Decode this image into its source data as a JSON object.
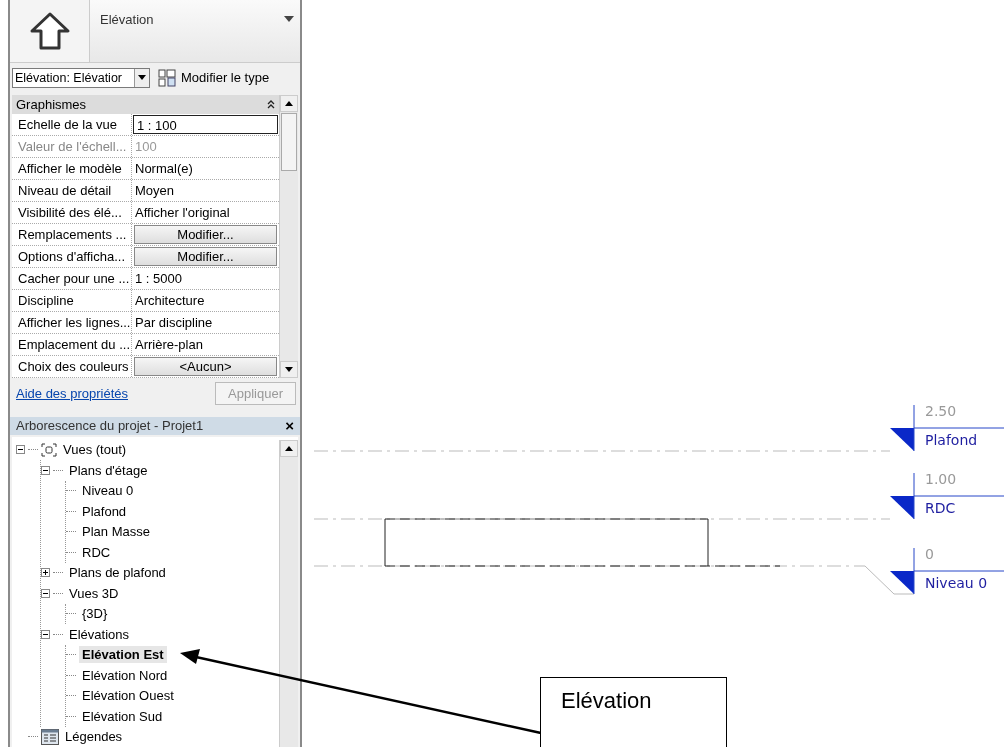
{
  "type_selector": {
    "label": "Elévation"
  },
  "instance_bar": {
    "combo_value": "Elévation: Elévatior",
    "edit_type_label": "Modifier le type"
  },
  "properties": {
    "group": "Graphismes",
    "expanded": true,
    "rows": [
      {
        "label": "Echelle de la vue",
        "value": "1 : 100",
        "kind": "field"
      },
      {
        "label": "Valeur de l'échell...",
        "value": "100",
        "kind": "disabled"
      },
      {
        "label": "Afficher le modèle",
        "value": "Normal(e)",
        "kind": "text"
      },
      {
        "label": "Niveau de détail",
        "value": "Moyen",
        "kind": "text"
      },
      {
        "label": "Visibilité des élé...",
        "value": "Afficher l'original",
        "kind": "text"
      },
      {
        "label": "Remplacements ...",
        "value": "Modifier...",
        "kind": "button"
      },
      {
        "label": "Options d'afficha...",
        "value": "Modifier...",
        "kind": "button"
      },
      {
        "label": "Cacher pour une ...",
        "value": "1 : 5000",
        "kind": "text"
      },
      {
        "label": "Discipline",
        "value": "Architecture",
        "kind": "text"
      },
      {
        "label": "Afficher les lignes...",
        "value": "Par discipline",
        "kind": "text"
      },
      {
        "label": "Emplacement du ...",
        "value": "Arrière-plan",
        "kind": "text"
      },
      {
        "label": "Choix des couleurs",
        "value": "<Aucun>",
        "kind": "button"
      }
    ],
    "help_link": "Aide des propriétés",
    "apply_button": {
      "label": "Appliquer",
      "disabled": true
    }
  },
  "project_browser": {
    "title": "Arborescence du projet - Projet1",
    "close": "×",
    "tree": [
      {
        "label": "Vues (tout)",
        "kind": "views",
        "expanded": true,
        "selected": false,
        "children": [
          {
            "label": "Plans d'étage",
            "expanded": true,
            "selected": false,
            "children": [
              {
                "label": "Niveau 0",
                "selected": false
              },
              {
                "label": "Plafond",
                "selected": false
              },
              {
                "label": "Plan Masse",
                "selected": false
              },
              {
                "label": "RDC",
                "selected": false
              }
            ]
          },
          {
            "label": "Plans de plafond",
            "expanded": false,
            "selected": false
          },
          {
            "label": "Vues 3D",
            "expanded": true,
            "selected": false,
            "children": [
              {
                "label": "{3D}",
                "selected": false
              }
            ]
          },
          {
            "label": "Elévations",
            "expanded": true,
            "selected": false,
            "children": [
              {
                "label": "Elévation Est",
                "selected": true
              },
              {
                "label": "Elévation Nord",
                "selected": false
              },
              {
                "label": "Elévation Ouest",
                "selected": false
              },
              {
                "label": "Elévation Sud",
                "selected": false
              }
            ]
          }
        ]
      },
      {
        "label": "Légendes",
        "kind": "legend",
        "selected": false
      }
    ]
  },
  "drawing": {
    "levels": [
      {
        "elevation": "2.50",
        "name": "Plafond"
      },
      {
        "elevation": "1.00",
        "name": "RDC"
      },
      {
        "elevation": "0",
        "name": "Niveau 0"
      }
    ]
  },
  "callout": {
    "text": "Elévation"
  }
}
